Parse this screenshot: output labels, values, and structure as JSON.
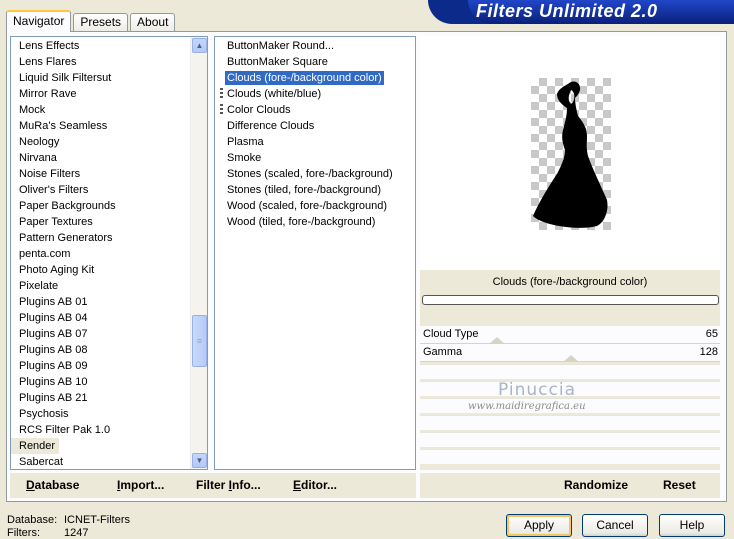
{
  "tabs": [
    {
      "label": "Navigator",
      "active": true
    },
    {
      "label": "Presets",
      "active": false
    },
    {
      "label": "About",
      "active": false
    }
  ],
  "banner": {
    "title": "Filters Unlimited 2.0"
  },
  "categories": {
    "items": [
      "Lens Effects",
      "Lens Flares",
      "Liquid Silk Filtersut",
      "Mirror Rave",
      "Mock",
      "MuRa's Seamless",
      "Neology",
      "Nirvana",
      "Noise Filters",
      "Oliver's Filters",
      "Paper Backgrounds",
      "Paper Textures",
      "Pattern Generators",
      "penta.com",
      "Photo Aging Kit",
      "Pixelate",
      "Plugins AB 01",
      "Plugins AB 04",
      "Plugins AB 07",
      "Plugins AB 08",
      "Plugins AB 09",
      "Plugins AB 10",
      "Plugins AB 21",
      "Psychosis",
      "RCS Filter Pak 1.0",
      "Render",
      "Sabercat"
    ],
    "selected": "Render"
  },
  "filters": {
    "items": [
      {
        "label": "ButtonMaker Round...",
        "marked": false
      },
      {
        "label": "ButtonMaker Square",
        "marked": false
      },
      {
        "label": "Clouds (fore-/background color)",
        "marked": false,
        "selected": true
      },
      {
        "label": "Clouds (white/blue)",
        "marked": true
      },
      {
        "label": "Color Clouds",
        "marked": true
      },
      {
        "label": "Difference Clouds",
        "marked": false
      },
      {
        "label": "Plasma",
        "marked": false
      },
      {
        "label": "Smoke",
        "marked": false
      },
      {
        "label": "Stones (scaled, fore-/background)",
        "marked": false
      },
      {
        "label": "Stones (tiled, fore-/background)",
        "marked": false
      },
      {
        "label": "Wood (scaled, fore-/background)",
        "marked": false
      },
      {
        "label": "Wood (tiled, fore-/background)",
        "marked": false
      }
    ]
  },
  "settings": {
    "filter_name": "Clouds (fore-/background color)",
    "params": [
      {
        "label": "Cloud Type",
        "value": "65",
        "level": 0.25
      },
      {
        "label": "Gamma",
        "value": "128",
        "level": 0.5
      }
    ]
  },
  "watermark": {
    "line1": "Pinuccia",
    "line2": "www.maidiregrafica.eu"
  },
  "toolbar": {
    "database": {
      "u": "D",
      "rest": "atabase"
    },
    "import": {
      "u": "I",
      "rest": "mport..."
    },
    "filter_info": {
      "pre": "Filter ",
      "u": "I",
      "rest": "nfo..."
    },
    "editor": {
      "u": "E",
      "rest": "ditor..."
    },
    "randomize": "Randomize",
    "reset": "Reset"
  },
  "footer": {
    "database_label": "Database:",
    "database_value": "ICNET-Filters",
    "filters_label": "Filters:",
    "filters_value": "1247"
  },
  "buttons": {
    "apply": "Apply",
    "cancel": "Cancel",
    "help": "Help"
  },
  "colors": {
    "selection": "#316ac5",
    "banner": "#0b2a8a"
  }
}
